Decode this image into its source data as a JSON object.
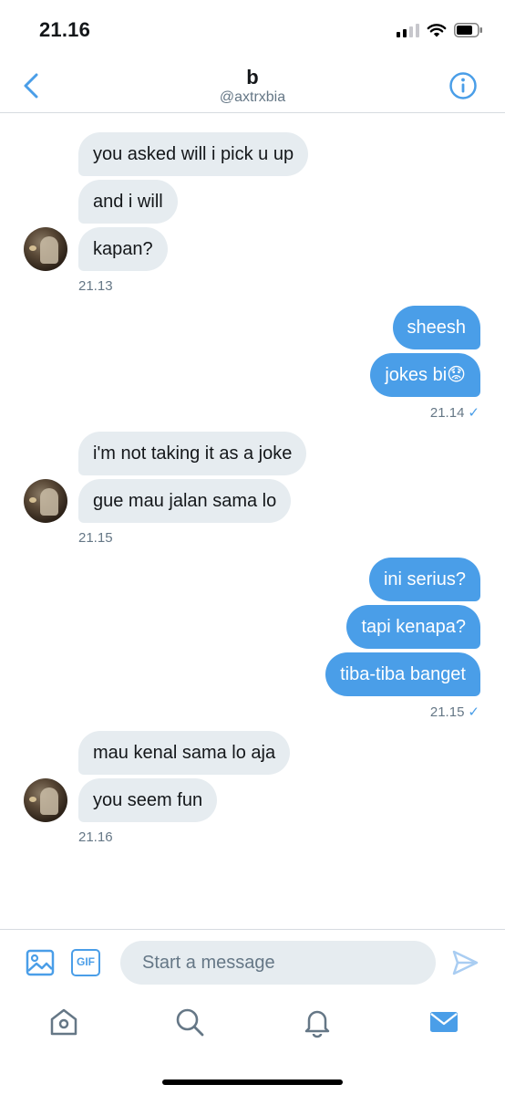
{
  "status_bar": {
    "time": "21.16"
  },
  "header": {
    "name": "b",
    "handle": "@axtrxbia"
  },
  "conversation": {
    "groups": [
      {
        "direction": "in",
        "messages": [
          "you asked will i pick u up",
          "and i will",
          "kapan?"
        ],
        "time": "21.13"
      },
      {
        "direction": "out",
        "messages": [
          "sheesh",
          "jokes bi😟"
        ],
        "time": "21.14",
        "check": "✓"
      },
      {
        "direction": "in",
        "messages": [
          "i'm not taking it as a joke",
          "gue mau jalan sama lo"
        ],
        "time": "21.15"
      },
      {
        "direction": "out",
        "messages": [
          "ini serius?",
          "tapi kenapa?",
          "tiba-tiba banget"
        ],
        "time": "21.15",
        "check": "✓"
      },
      {
        "direction": "in",
        "messages": [
          "mau kenal sama lo aja",
          "you seem fun"
        ],
        "time": "21.16"
      }
    ]
  },
  "composer": {
    "placeholder": "Start a message",
    "gif_label": "GIF"
  },
  "icons": {
    "back": "chevron-left-icon",
    "info": "info-icon",
    "image": "image-icon",
    "gif": "gif-icon",
    "send": "send-icon",
    "home": "home-icon",
    "search": "search-icon",
    "notifications": "bell-icon",
    "messages": "mail-icon"
  },
  "colors": {
    "accent": "#4a9ee8",
    "incoming_bubble": "#e6ecf0",
    "muted_text": "#657786",
    "divider": "#d6dbe0"
  }
}
